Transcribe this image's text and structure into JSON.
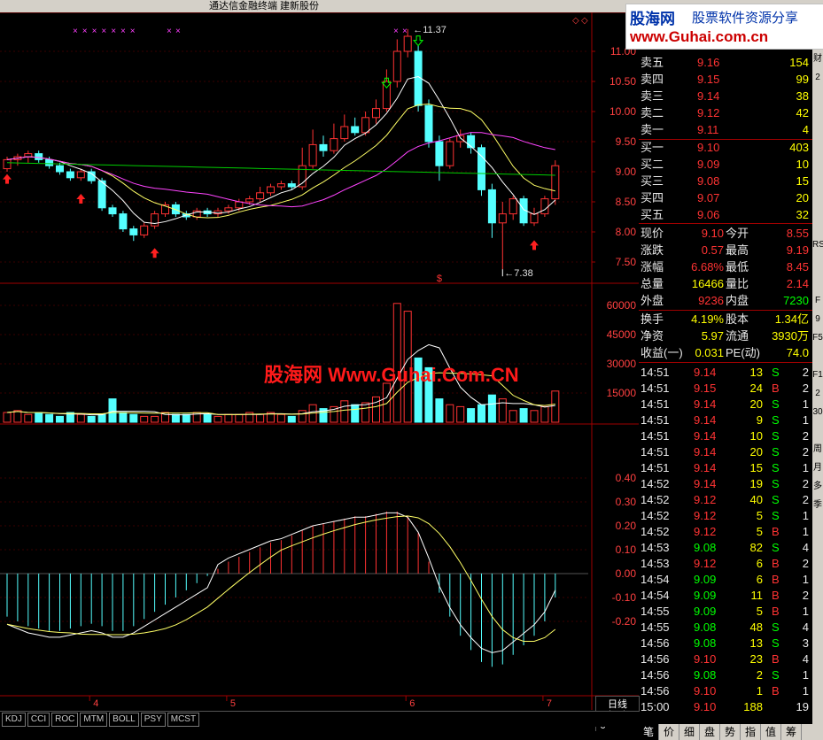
{
  "window": {
    "title": "通达信金融终端  建新股份"
  },
  "logo": {
    "brand": "股海网",
    "slogan": "股票软件资源分享",
    "url": "www.Guhai.com.cn"
  },
  "watermark": "股海网 Www.Guhai.Com.CN",
  "price_axis": [
    "11.00",
    "10.50",
    "10.00",
    "9.50",
    "9.00",
    "8.50",
    "8.00",
    "7.50"
  ],
  "vol_axis": [
    "60000",
    "45000",
    "30000",
    "15000"
  ],
  "macd_axis": [
    "0.40",
    "0.30",
    "0.20",
    "0.10",
    "0.00",
    "-0.10",
    "-0.20"
  ],
  "date_labels": [
    "4",
    "5",
    "6",
    "7"
  ],
  "annotations": {
    "high": "11.37",
    "low": "7.38",
    "marker": "$"
  },
  "day_label": "日线",
  "zoom": [
    "↑",
    "+",
    "-",
    "0"
  ],
  "indicator_tabs": [
    "KDJ",
    "CCI",
    "ROC",
    "MTM",
    "BOLL",
    "PSY",
    "MCST"
  ],
  "sell_levels": [
    {
      "label": "卖五",
      "price": "9.16",
      "vol": "154"
    },
    {
      "label": "卖四",
      "price": "9.15",
      "vol": "99"
    },
    {
      "label": "卖三",
      "price": "9.14",
      "vol": "38"
    },
    {
      "label": "卖二",
      "price": "9.12",
      "vol": "42"
    },
    {
      "label": "卖一",
      "price": "9.11",
      "vol": "4"
    }
  ],
  "buy_levels": [
    {
      "label": "买一",
      "price": "9.10",
      "vol": "403"
    },
    {
      "label": "买二",
      "price": "9.09",
      "vol": "10"
    },
    {
      "label": "买三",
      "price": "9.08",
      "vol": "15"
    },
    {
      "label": "买四",
      "price": "9.07",
      "vol": "20"
    },
    {
      "label": "买五",
      "price": "9.06",
      "vol": "32"
    }
  ],
  "quote": [
    {
      "k1": "现价",
      "v1": "9.10",
      "k2": "今开",
      "v2": "8.55"
    },
    {
      "k1": "涨跌",
      "v1": "0.57",
      "k2": "最高",
      "v2": "9.19"
    },
    {
      "k1": "涨幅",
      "v1": "6.68%",
      "k2": "最低",
      "v2": "8.45"
    },
    {
      "k1": "总量",
      "v1": "16466",
      "k2": "量比",
      "v2": "2.14"
    },
    {
      "k1": "外盘",
      "v1": "9236",
      "k2": "内盘",
      "v2": "7230"
    }
  ],
  "fund": [
    {
      "k1": "换手",
      "v1": "4.19%",
      "k2": "股本",
      "v2": "1.34亿"
    },
    {
      "k1": "净资",
      "v1": "5.97",
      "k2": "流通",
      "v2": "3930万"
    },
    {
      "k1": "收益(一)",
      "v1": "0.031",
      "k2": "PE(动)",
      "v2": "74.0"
    }
  ],
  "ticks": [
    {
      "t": "14:51",
      "p": "9.14",
      "v": "13",
      "s": "S",
      "n": "2"
    },
    {
      "t": "14:51",
      "p": "9.15",
      "v": "24",
      "s": "B",
      "n": "2"
    },
    {
      "t": "14:51",
      "p": "9.14",
      "v": "20",
      "s": "S",
      "n": "1"
    },
    {
      "t": "14:51",
      "p": "9.14",
      "v": "9",
      "s": "S",
      "n": "1"
    },
    {
      "t": "14:51",
      "p": "9.14",
      "v": "10",
      "s": "S",
      "n": "2"
    },
    {
      "t": "14:51",
      "p": "9.14",
      "v": "20",
      "s": "S",
      "n": "2"
    },
    {
      "t": "14:51",
      "p": "9.14",
      "v": "15",
      "s": "S",
      "n": "1"
    },
    {
      "t": "14:52",
      "p": "9.14",
      "v": "19",
      "s": "S",
      "n": "2"
    },
    {
      "t": "14:52",
      "p": "9.12",
      "v": "40",
      "s": "S",
      "n": "2"
    },
    {
      "t": "14:52",
      "p": "9.12",
      "v": "5",
      "s": "S",
      "n": "1"
    },
    {
      "t": "14:52",
      "p": "9.12",
      "v": "5",
      "s": "B",
      "n": "1"
    },
    {
      "t": "14:53",
      "p": "9.08",
      "v": "82",
      "s": "S",
      "n": "4"
    },
    {
      "t": "14:53",
      "p": "9.12",
      "v": "6",
      "s": "B",
      "n": "2"
    },
    {
      "t": "14:54",
      "p": "9.09",
      "v": "6",
      "s": "B",
      "n": "1"
    },
    {
      "t": "14:54",
      "p": "9.09",
      "v": "11",
      "s": "B",
      "n": "2"
    },
    {
      "t": "14:55",
      "p": "9.09",
      "v": "5",
      "s": "B",
      "n": "1"
    },
    {
      "t": "14:55",
      "p": "9.08",
      "v": "48",
      "s": "S",
      "n": "4"
    },
    {
      "t": "14:56",
      "p": "9.08",
      "v": "13",
      "s": "S",
      "n": "3"
    },
    {
      "t": "14:56",
      "p": "9.10",
      "v": "23",
      "s": "B",
      "n": "4"
    },
    {
      "t": "14:56",
      "p": "9.08",
      "v": "2",
      "s": "S",
      "n": "1"
    },
    {
      "t": "14:56",
      "p": "9.10",
      "v": "1",
      "s": "B",
      "n": "1"
    },
    {
      "t": "15:00",
      "p": "9.10",
      "v": "188",
      "s": "",
      "n": "19"
    }
  ],
  "bottom_tabs": [
    "笔",
    "价",
    "细",
    "盘",
    "势",
    "指",
    "值",
    "筹"
  ],
  "edge_labels": [
    "财",
    "2",
    "",
    "",
    "",
    "",
    "",
    "",
    "",
    "",
    "RS",
    "",
    "",
    "F",
    "9",
    "F5",
    "",
    "F1",
    "2",
    "30",
    "",
    "周",
    "月",
    "多",
    "季",
    "",
    "",
    "",
    ""
  ],
  "candles": [
    [
      9.05,
      9.2,
      9.25,
      9.0
    ],
    [
      9.2,
      9.25,
      9.3,
      9.1
    ],
    [
      9.25,
      9.3,
      9.35,
      9.15
    ],
    [
      9.3,
      9.2,
      9.35,
      9.15
    ],
    [
      9.2,
      9.1,
      9.25,
      9.05
    ],
    [
      9.1,
      9.0,
      9.15,
      8.95
    ],
    [
      9.0,
      8.9,
      9.05,
      8.85
    ],
    [
      8.9,
      9.0,
      9.05,
      8.85
    ],
    [
      9.0,
      8.85,
      9.05,
      8.8
    ],
    [
      8.85,
      8.4,
      8.9,
      8.35
    ],
    [
      8.4,
      8.3,
      8.45,
      8.25
    ],
    [
      8.3,
      8.05,
      8.35,
      8.0
    ],
    [
      8.05,
      7.95,
      8.1,
      7.85
    ],
    [
      7.95,
      8.1,
      8.15,
      7.9
    ],
    [
      8.1,
      8.3,
      8.35,
      8.05
    ],
    [
      8.3,
      8.45,
      8.5,
      8.25
    ],
    [
      8.45,
      8.3,
      8.5,
      8.25
    ],
    [
      8.3,
      8.25,
      8.35,
      8.2
    ],
    [
      8.25,
      8.35,
      8.4,
      8.2
    ],
    [
      8.35,
      8.3,
      8.4,
      8.25
    ],
    [
      8.3,
      8.35,
      8.4,
      8.25
    ],
    [
      8.35,
      8.4,
      8.45,
      8.3
    ],
    [
      8.4,
      8.5,
      8.55,
      8.35
    ],
    [
      8.5,
      8.55,
      8.6,
      8.45
    ],
    [
      8.55,
      8.65,
      8.75,
      8.5
    ],
    [
      8.65,
      8.75,
      8.8,
      8.6
    ],
    [
      8.75,
      8.8,
      8.85,
      8.7
    ],
    [
      8.8,
      8.75,
      8.85,
      8.7
    ],
    [
      8.75,
      9.1,
      9.4,
      8.7
    ],
    [
      9.1,
      9.45,
      9.7,
      9.05
    ],
    [
      9.45,
      9.35,
      9.6,
      9.25
    ],
    [
      9.35,
      9.55,
      9.8,
      9.3
    ],
    [
      9.55,
      9.75,
      9.95,
      9.5
    ],
    [
      9.75,
      9.65,
      9.9,
      9.6
    ],
    [
      9.65,
      9.9,
      10.0,
      9.6
    ],
    [
      9.9,
      10.05,
      10.2,
      9.8
    ],
    [
      10.05,
      10.5,
      10.7,
      10.0
    ],
    [
      10.5,
      11.0,
      11.2,
      10.4
    ],
    [
      11.0,
      11.25,
      11.37,
      10.9
    ],
    [
      11.0,
      10.1,
      11.1,
      10.0
    ],
    [
      10.1,
      9.5,
      10.2,
      9.4
    ],
    [
      9.5,
      9.1,
      9.6,
      8.85
    ],
    [
      9.1,
      9.5,
      9.55,
      9.05
    ],
    [
      9.5,
      9.6,
      9.7,
      9.4
    ],
    [
      9.6,
      9.4,
      9.65,
      9.3
    ],
    [
      9.4,
      8.7,
      9.45,
      8.6
    ],
    [
      8.7,
      8.15,
      8.8,
      7.9
    ],
    [
      8.15,
      8.3,
      8.5,
      7.38
    ],
    [
      8.3,
      8.55,
      8.6,
      8.2
    ],
    [
      8.55,
      8.15,
      8.6,
      8.1
    ],
    [
      8.15,
      8.3,
      8.4,
      8.1
    ],
    [
      8.3,
      8.55,
      8.6,
      8.25
    ],
    [
      8.55,
      9.1,
      9.19,
      8.45
    ]
  ],
  "volumes": [
    5,
    6,
    4,
    5,
    4,
    3,
    5,
    4,
    3,
    4,
    12,
    5,
    4,
    3,
    3,
    5,
    4,
    4,
    5,
    4,
    3,
    4,
    4,
    5,
    4,
    5,
    4,
    3,
    6,
    9,
    7,
    8,
    11,
    9,
    10,
    13,
    20,
    61,
    57,
    33,
    28,
    12,
    9,
    8,
    7,
    9,
    14,
    12,
    6,
    7,
    6,
    8,
    16
  ],
  "macd_hist": [
    -0.18,
    -0.2,
    -0.22,
    -0.23,
    -0.24,
    -0.24,
    -0.23,
    -0.22,
    -0.21,
    -0.22,
    -0.24,
    -0.24,
    -0.22,
    -0.19,
    -0.16,
    -0.13,
    -0.1,
    -0.07,
    -0.04,
    -0.01,
    0.02,
    0.05,
    0.07,
    0.09,
    0.11,
    0.13,
    0.14,
    0.16,
    0.18,
    0.2,
    0.21,
    0.22,
    0.23,
    0.24,
    0.24,
    0.25,
    0.26,
    0.26,
    0.24,
    0.17,
    0.05,
    -0.08,
    -0.18,
    -0.26,
    -0.32,
    -0.37,
    -0.39,
    -0.38,
    -0.34,
    -0.3,
    -0.26,
    -0.2,
    -0.1
  ]
}
